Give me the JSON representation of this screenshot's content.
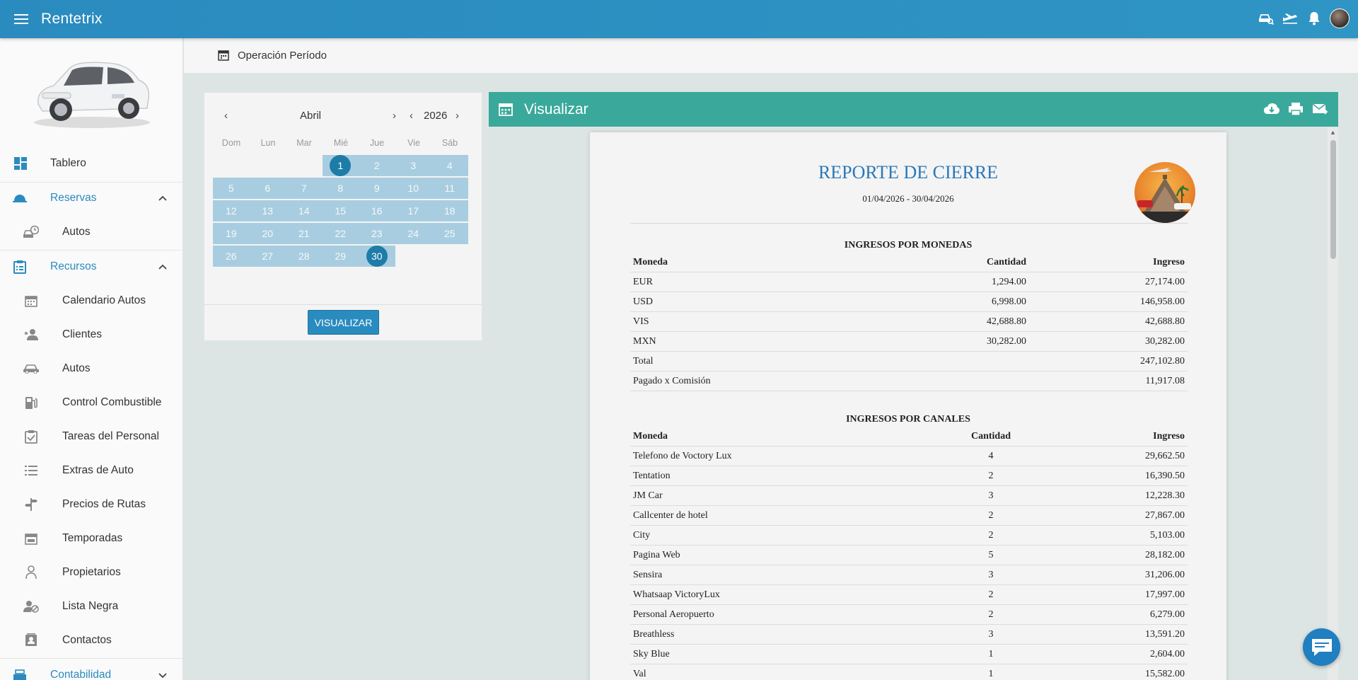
{
  "app": {
    "title": "Rentetrix"
  },
  "sidebar": {
    "items": [
      {
        "label": "Tablero"
      },
      {
        "label": "Reservas"
      },
      {
        "label": "Autos"
      },
      {
        "label": "Recursos"
      },
      {
        "label": "Calendario Autos"
      },
      {
        "label": "Clientes"
      },
      {
        "label": "Autos"
      },
      {
        "label": "Control Combustible"
      },
      {
        "label": "Tareas del Personal"
      },
      {
        "label": "Extras de Auto"
      },
      {
        "label": "Precios de Rutas"
      },
      {
        "label": "Temporadas"
      },
      {
        "label": "Propietarios"
      },
      {
        "label": "Lista Negra"
      },
      {
        "label": "Contactos"
      },
      {
        "label": "Contabilidad"
      }
    ]
  },
  "subheader": {
    "title": "Operación Período"
  },
  "calendar": {
    "month": "Abril",
    "year": "2026",
    "weekdays": [
      "Dom",
      "Lun",
      "Mar",
      "Mié",
      "Jue",
      "Vie",
      "Sáb"
    ],
    "days": [
      "1",
      "2",
      "3",
      "4",
      "5",
      "6",
      "7",
      "8",
      "9",
      "10",
      "11",
      "12",
      "13",
      "14",
      "15",
      "16",
      "17",
      "18",
      "19",
      "20",
      "21",
      "22",
      "23",
      "24",
      "25",
      "26",
      "27",
      "28",
      "29",
      "30"
    ],
    "button": "VISUALIZAR"
  },
  "panel": {
    "title": "Visualizar"
  },
  "report": {
    "title": "REPORTE DE CIERRE",
    "range": "01/04/2026 - 30/04/2026",
    "monedas": {
      "title": "INGRESOS POR MONEDAS",
      "headers": [
        "Moneda",
        "Cantidad",
        "Ingreso"
      ],
      "rows": [
        [
          "EUR",
          "1,294.00",
          "27,174.00"
        ],
        [
          "USD",
          "6,998.00",
          "146,958.00"
        ],
        [
          "VIS",
          "42,688.80",
          "42,688.80"
        ],
        [
          "MXN",
          "30,282.00",
          "30,282.00"
        ],
        [
          "Total",
          "",
          "247,102.80"
        ],
        [
          "Pagado x Comisión",
          "",
          "11,917.08"
        ]
      ]
    },
    "canales": {
      "title": "INGRESOS POR CANALES",
      "headers": [
        "Moneda",
        "Cantidad",
        "Ingreso"
      ],
      "rows": [
        [
          "Telefono de Voctory Lux",
          "4",
          "29,662.50"
        ],
        [
          "Tentation",
          "2",
          "16,390.50"
        ],
        [
          "JM Car",
          "3",
          "12,228.30"
        ],
        [
          "Callcenter de hotel",
          "2",
          "27,867.00"
        ],
        [
          "City",
          "2",
          "5,103.00"
        ],
        [
          "Pagina Web",
          "5",
          "28,182.00"
        ],
        [
          "Sensira",
          "3",
          "31,206.00"
        ],
        [
          "Whatsaap VictoryLux",
          "2",
          "17,997.00"
        ],
        [
          "Personal Aeropuerto",
          "2",
          "6,279.00"
        ],
        [
          "Breathless",
          "3",
          "13,591.20"
        ],
        [
          "Sky Blue",
          "1",
          "2,604.00"
        ],
        [
          "Val",
          "1",
          "15,582.00"
        ]
      ]
    }
  }
}
